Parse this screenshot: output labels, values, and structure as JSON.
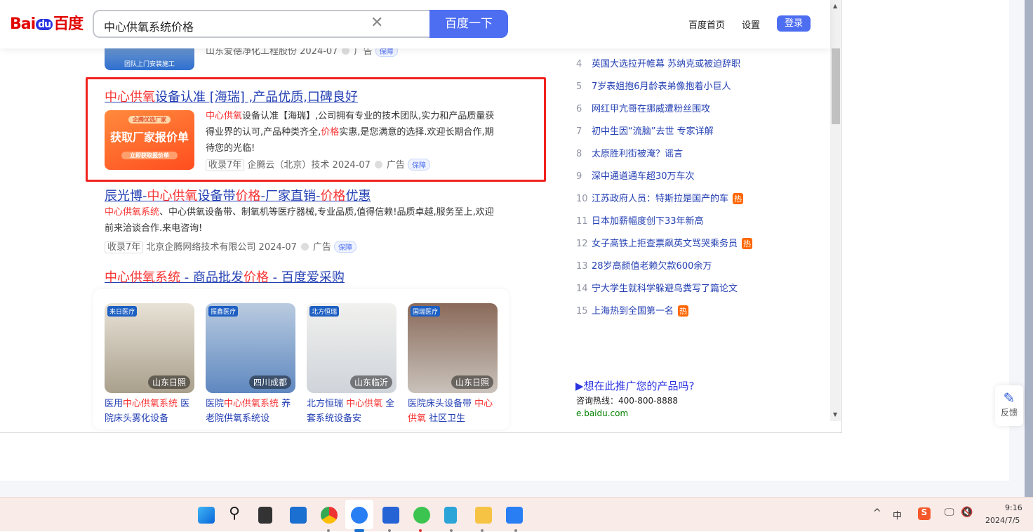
{
  "header": {
    "logo": "Bai du 百度",
    "query": "中心供氧系统价格",
    "search_button": "百度一下",
    "links": [
      "百度首页",
      "设置"
    ],
    "login": "登录"
  },
  "prev_result": {
    "meta": "山东爱德净化工程股份 2024-07",
    "ad": "广告",
    "badge": "保障",
    "img_text": "团队上门安装施工"
  },
  "ad1": {
    "title_hl": "中心供氧",
    "title_rest": "设备认准 [海瑞] ,产品优质,口碑良好",
    "img_title": "获取厂家报价单",
    "img_top": "企腾优选厂家",
    "img_btn": "立即获取报价单",
    "desc_hl": "中心供氧",
    "desc1": "设备认准【海瑞】,公司拥有专业的技术团队,实力和产品质量获得业界的认可,产品种类齐全,",
    "desc_hl2": "价格",
    "desc2": "实惠,是您满意的选择.欢迎长期合作,期待您的光临!",
    "tag": "收录7年",
    "source": "企腾云（北京）技术 2024-07",
    "ad": "广告",
    "badge": "保障"
  },
  "ad2": {
    "t1": "辰光博-",
    "t2": "中心供氧",
    "t3": "设备带",
    "t4": "价格",
    "t5": "-厂家直销-",
    "t6": "价格",
    "t7": "优惠",
    "desc_hl": "中心供氧系统",
    "desc": "、中心供氧设备带、制氧机等医疗器械,专业品质,值得信赖!品质卓越,服务至上,欢迎前来洽谈合作.来电咨询!",
    "tag": "收录7年",
    "source": "北京企腾网络技术有限公司 2024-07",
    "ad": "广告",
    "badge": "保障"
  },
  "shop": {
    "t1": "中心供氧系统",
    "t2": " - 商品批发",
    "t3": "价格",
    "t4": " - 百度爱采购",
    "cards": [
      {
        "loc": "山东日照",
        "badge": "来日医疗",
        "c1": "医用",
        "c2": "中心供氧系统",
        "c3": " 医院床头雾化设备"
      },
      {
        "loc": "四川成都",
        "badge": "振鑫医疗",
        "c1": "医院",
        "c2": "中心供氧系统",
        "c3": " 养老院供氧系统设"
      },
      {
        "loc": "山东临沂",
        "badge": "北方恒瑞",
        "c1": "北方恒瑞 ",
        "c2": "中心供氧",
        "c3": " 全套系统设备安"
      },
      {
        "loc": "山东日照",
        "badge": "国瑞医疗",
        "c1": "医院床头设备带 ",
        "c2": "中心供氧",
        "c3": " 社区卫生"
      }
    ]
  },
  "hot": [
    {
      "n": "4",
      "t": "英国大选拉开帷幕 苏纳克或被迫辞职"
    },
    {
      "n": "5",
      "t": "7岁表姐抱6月龄表弟像抱着小巨人"
    },
    {
      "n": "6",
      "t": "网红甲亢哥在挪威遭粉丝围攻"
    },
    {
      "n": "7",
      "t": "初中生因“流脑”去世 专家详解"
    },
    {
      "n": "8",
      "t": "太原胜利街被淹？谣言"
    },
    {
      "n": "9",
      "t": "深中通道通车超30万车次"
    },
    {
      "n": "10",
      "t": "江苏政府人员：特斯拉是国产的车",
      "hot": "热"
    },
    {
      "n": "11",
      "t": "日本加薪幅度创下33年新高"
    },
    {
      "n": "12",
      "t": "女子高铁上拒查票飙英文骂哭乘务员",
      "hot": "热"
    },
    {
      "n": "13",
      "t": "28岁高颜值老赖欠款600余万"
    },
    {
      "n": "14",
      "t": "宁大学生就科学躲避鸟粪写了篇论文"
    },
    {
      "n": "15",
      "t": "上海热到全国第一名",
      "hot": "热"
    }
  ],
  "promo": {
    "link": "▶想在此推广您的产品吗?",
    "phone": "咨询热线：400-800-8888",
    "site": "e.baidu.com"
  },
  "feedback": "反馈",
  "tray": {
    "ime": "中",
    "time": "9:16",
    "date": "2024/7/5"
  }
}
